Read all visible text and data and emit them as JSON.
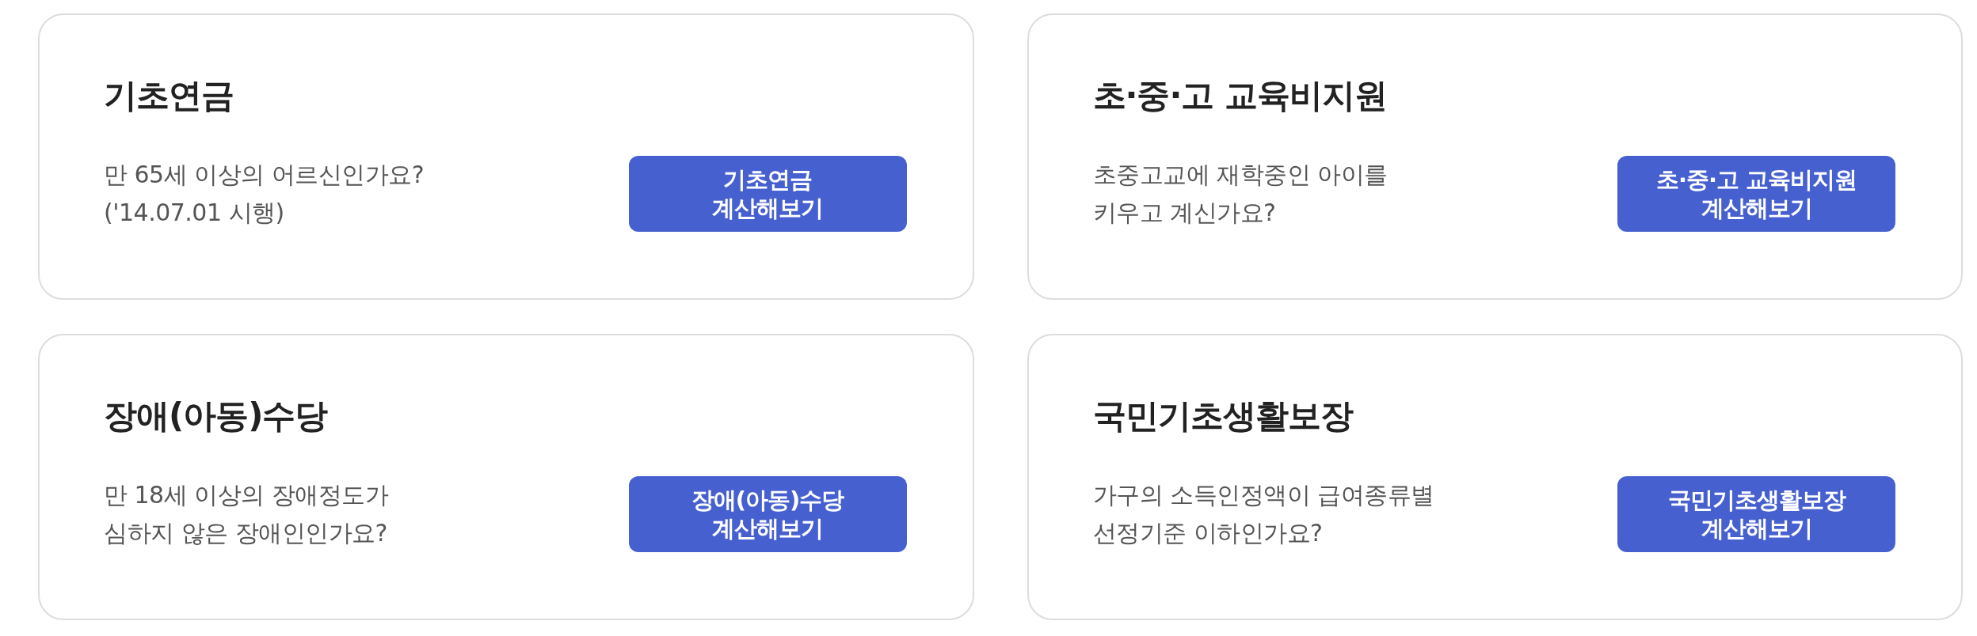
{
  "cards": [
    {
      "title": "기초연금",
      "description": [
        "만 65세 이상의 어르신인가요?",
        "('14.07.01 시행)"
      ],
      "button": [
        "기초연금",
        "계산해보기"
      ]
    },
    {
      "title": "초·중·고 교육비지원",
      "description": [
        "초중고교에 재학중인 아이를",
        "키우고 계신가요?"
      ],
      "button": [
        "초·중·고 교육비지원",
        "계산해보기"
      ]
    },
    {
      "title": "장애(아동)수당",
      "description": [
        "만 18세 이상의 장애정도가",
        "심하지 않은 장애인인가요?"
      ],
      "button": [
        "장애(아동)수당",
        "계산해보기"
      ]
    },
    {
      "title": "국민기초생활보장",
      "description": [
        "가구의 소득인정액이 급여종류별",
        "선정기준 이하인가요?"
      ],
      "button": [
        "국민기초생활보장",
        "계산해보기"
      ]
    }
  ]
}
